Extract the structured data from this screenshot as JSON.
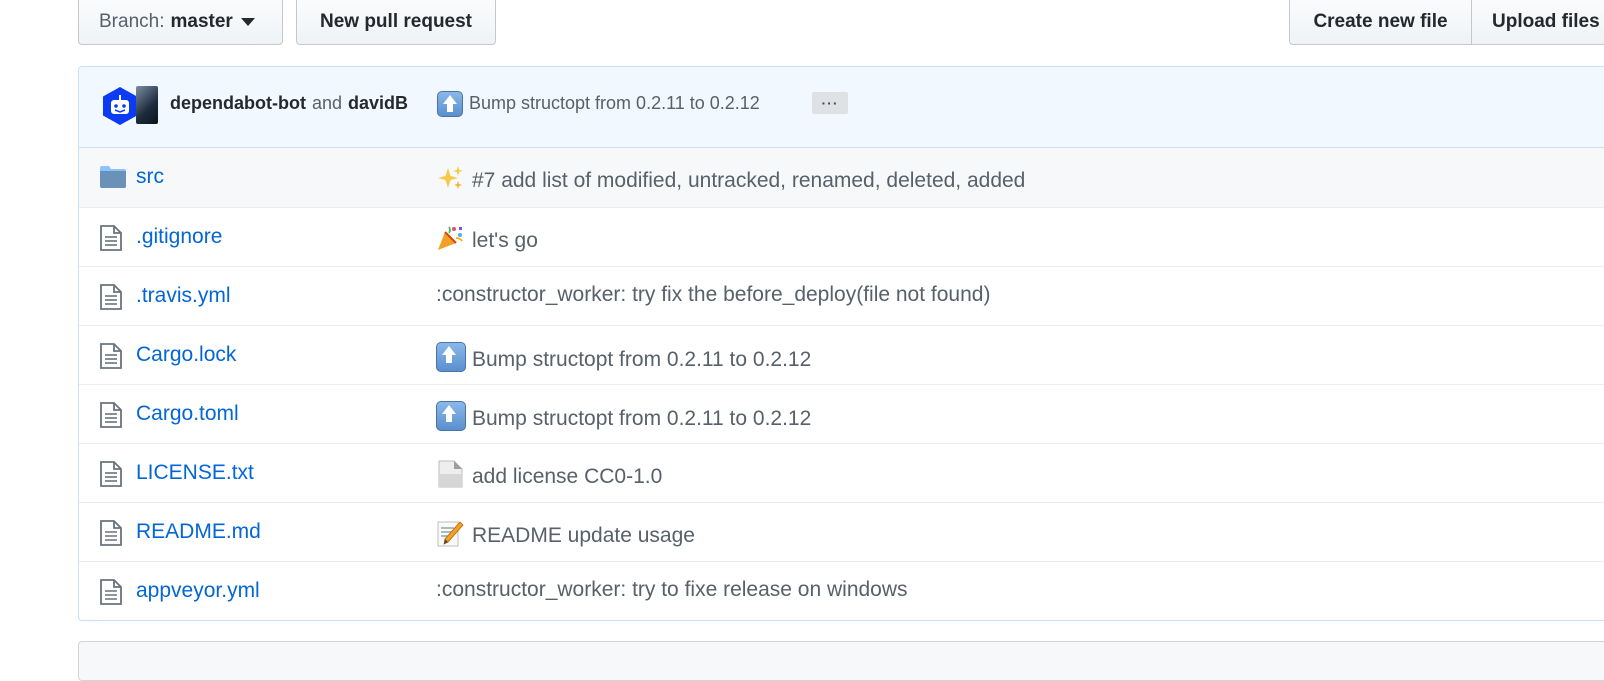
{
  "toolbar": {
    "branch_label": "Branch:",
    "branch_value": "master",
    "new_pr_label": "New pull request",
    "create_file_label": "Create new file",
    "upload_label": "Upload files"
  },
  "latest_commit": {
    "author1": "dependabot-bot",
    "and_text": "and",
    "author2": "davidB",
    "message": "Bump structopt from 0.2.11 to 0.2.12",
    "ellipsis": "···"
  },
  "files": [
    {
      "name": "src",
      "type": "folder",
      "emoji": "sparkles-icon",
      "message": "#7 add list of modified, untracked, renamed, deleted, added"
    },
    {
      "name": ".gitignore",
      "type": "file",
      "emoji": "tada-icon",
      "message": "let's go"
    },
    {
      "name": ".travis.yml",
      "type": "file",
      "emoji": "",
      "message": ":constructor_worker: try fix the before_deploy(file not found)"
    },
    {
      "name": "Cargo.lock",
      "type": "file",
      "emoji": "arrow-up-icon",
      "message": "Bump structopt from 0.2.11 to 0.2.12"
    },
    {
      "name": "Cargo.toml",
      "type": "file",
      "emoji": "arrow-up-icon",
      "message": "Bump structopt from 0.2.11 to 0.2.12"
    },
    {
      "name": "LICENSE.txt",
      "type": "file",
      "emoji": "page-facing-up-icon",
      "message": "add license CC0-1.0"
    },
    {
      "name": "README.md",
      "type": "file",
      "emoji": "memo-icon",
      "message": "README update usage"
    },
    {
      "name": "appveyor.yml",
      "type": "file",
      "emoji": "",
      "message": ":constructor_worker: try to fixe release on windows"
    }
  ],
  "colors": {
    "link": "#0366d6",
    "commit_bar_bg": "#f1f8ff",
    "folder": "#79b8ff"
  }
}
